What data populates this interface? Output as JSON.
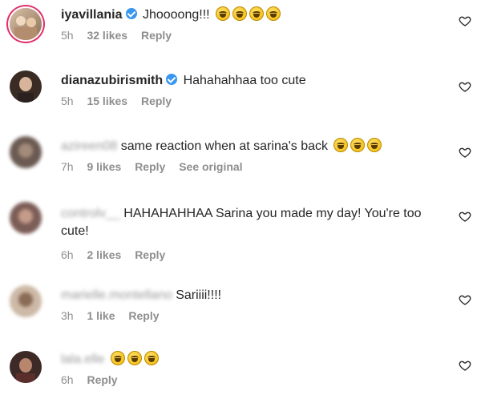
{
  "icons": {
    "like": "heart-outline-icon",
    "verified": "verified-badge-icon",
    "emoji": "tears-of-joy-emoji"
  },
  "colors": {
    "text": "#262626",
    "meta": "#8e8e8e",
    "verified": "#3897f0"
  },
  "comments": [
    {
      "username": "iyavillania",
      "verified": true,
      "text": "Jhoooong!!!",
      "time": "5h",
      "likes": "32 likes",
      "reply": "Reply",
      "emoji_count": 4
    },
    {
      "username": "dianazubirismith",
      "verified": true,
      "text": "Hahahahhaa too cute",
      "time": "5h",
      "likes": "15 likes",
      "reply": "Reply",
      "emoji_count": 0
    },
    {
      "username": "azireen08",
      "verified": false,
      "text": "same reaction when at sarina's back",
      "time": "7h",
      "likes": "9 likes",
      "reply": "Reply",
      "extra": "See original",
      "emoji_count": 3
    },
    {
      "username": "controlv__",
      "verified": false,
      "text": "HAHAHAHHAA Sarina you made my day! You're too cute!",
      "time": "6h",
      "likes": "2 likes",
      "reply": "Reply",
      "emoji_count": 0
    },
    {
      "username": "marielle.montellano",
      "verified": false,
      "text": "Sariiii!!!!",
      "time": "3h",
      "likes": "1 like",
      "reply": "Reply",
      "emoji_count": 0
    },
    {
      "username": "lala.elle",
      "verified": false,
      "text": "",
      "time": "6h",
      "likes": "",
      "reply": "Reply",
      "emoji_count": 3
    }
  ]
}
